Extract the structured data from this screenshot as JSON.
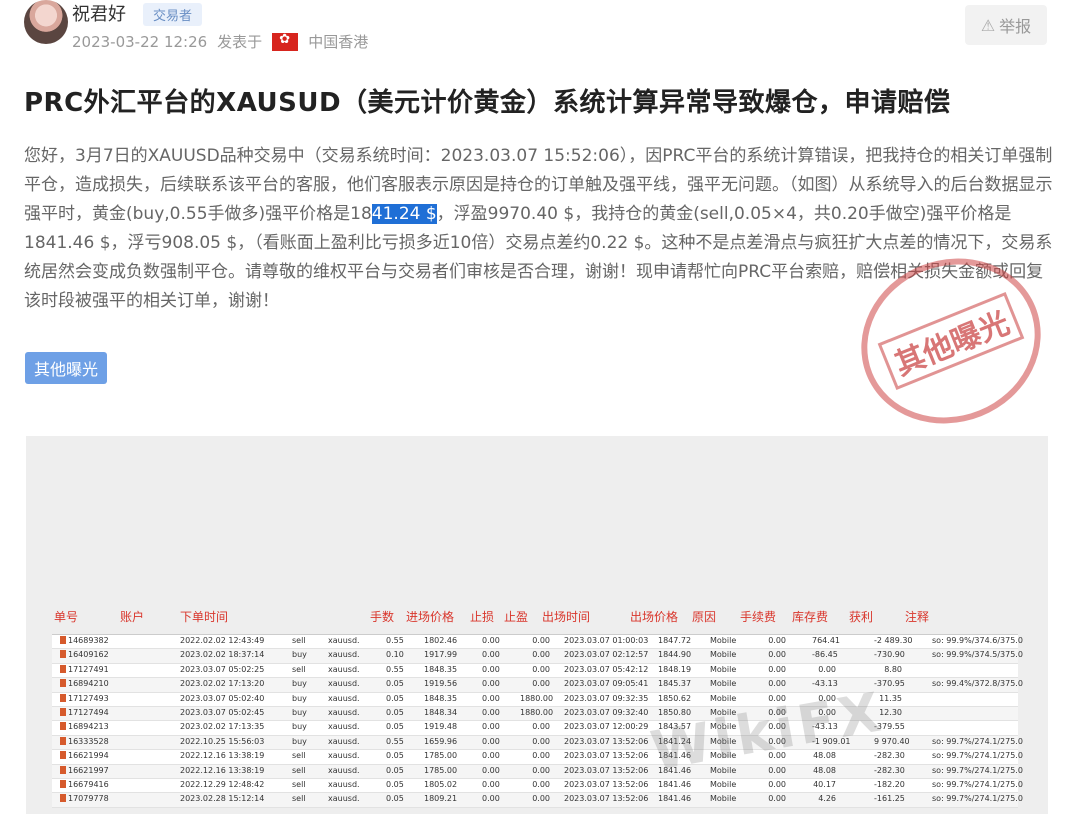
{
  "author": {
    "name": "祝君好",
    "badge": "交易者"
  },
  "post_meta": {
    "date": "2023-03-22 12:26",
    "posted_in": "发表于",
    "region": "中国香港"
  },
  "report_label": "举报",
  "title": "PRC外汇平台的XAUSUD（美元计价黄金）系统计算异常导致爆仓，申请赔偿",
  "body": {
    "before_hl": "您好，3月7日的XAUUSD品种交易中（交易系统时间：2023.03.07 15:52:06），因PRC平台的系统计算错误，把我持仓的相关订单强制平仓，造成损失，后续联系该平台的客服，他们客服表示原因是持仓的订单触及强平线，强平无问题。（如图）从系统导入的后台数据显示强平时，黄金(buy,0.55手做多)强平价格是18",
    "highlight": "41.24 $",
    "after_hl": "，浮盈9970.40 $，我持仓的黄金(sell,0.05×4，共0.20手做空)强平价格是1841.46 $，浮亏908.05 $，（看账面上盈利比亏损多近10倍）交易点差约0.22 $。这种不是点差滑点与疯狂扩大点差的情况下，交易系统居然会变成负数强制平仓。请尊敬的维权平台与交易者们审核是否合理，谢谢！现申请帮忙向PRC平台索赔，赔偿相关损失金额或回复该时段被强平的相关订单，谢谢！"
  },
  "tag": "其他曝光",
  "stamp_text": "其他曝光",
  "watermark_text": "WikiFX",
  "icons": {
    "report": "warning-triangle-icon",
    "flag": "hong-kong-flag-icon"
  },
  "colors": {
    "highlight": "#1f6fd6",
    "tag": "#6ea0e6",
    "header_red": "#d9362c"
  },
  "table": {
    "headers": [
      "单号",
      "账户",
      "下单时间",
      "手数",
      "进场价格",
      "止损",
      "止盈",
      "出场时间",
      "出场价格",
      "原因",
      "手续费",
      "库存费",
      "获利",
      "注释"
    ],
    "rows": [
      [
        "14689382",
        "",
        "2022.02.02 12:43:49",
        "sell",
        "xauusd.",
        "0.55",
        "1802.46",
        "0.00",
        "0.00",
        "2023.03.07 01:00:03",
        "1847.72",
        "Mobile",
        "0.00",
        "764.41",
        "-2 489.30",
        "so: 99.9%/374.6/375.0"
      ],
      [
        "16409162",
        "",
        "2023.02.02 18:37:14",
        "buy",
        "xauusd.",
        "0.10",
        "1917.99",
        "0.00",
        "0.00",
        "2023.03.07 02:12:57",
        "1844.90",
        "Mobile",
        "0.00",
        "-86.45",
        "-730.90",
        "so: 99.9%/374.5/375.0"
      ],
      [
        "17127491",
        "",
        "2023.03.07 05:02:25",
        "sell",
        "xauusd.",
        "0.55",
        "1848.35",
        "0.00",
        "0.00",
        "2023.03.07 05:42:12",
        "1848.19",
        "Mobile",
        "0.00",
        "0.00",
        "8.80",
        ""
      ],
      [
        "16894210",
        "",
        "2023.02.02 17:13:20",
        "buy",
        "xauusd.",
        "0.05",
        "1919.56",
        "0.00",
        "0.00",
        "2023.03.07 09:05:41",
        "1845.37",
        "Mobile",
        "0.00",
        "-43.13",
        "-370.95",
        "so: 99.4%/372.8/375.0"
      ],
      [
        "17127493",
        "",
        "2023.03.07 05:02:40",
        "buy",
        "xauusd.",
        "0.05",
        "1848.35",
        "0.00",
        "1880.00",
        "2023.03.07 09:32:35",
        "1850.62",
        "Mobile",
        "0.00",
        "0.00",
        "11.35",
        ""
      ],
      [
        "17127494",
        "",
        "2023.03.07 05:02:45",
        "buy",
        "xauusd.",
        "0.05",
        "1848.34",
        "0.00",
        "1880.00",
        "2023.03.07 09:32:40",
        "1850.80",
        "Mobile",
        "0.00",
        "0.00",
        "12.30",
        ""
      ],
      [
        "16894213",
        "",
        "2023.02.02 17:13:35",
        "buy",
        "xauusd.",
        "0.05",
        "1919.48",
        "0.00",
        "0.00",
        "2023.03.07 12:00:29",
        "1843.57",
        "Mobile",
        "0.00",
        "-43.13",
        "-379.55",
        ""
      ],
      [
        "16333528",
        "",
        "2022.10.25 15:56:03",
        "buy",
        "xauusd.",
        "0.55",
        "1659.96",
        "0.00",
        "0.00",
        "2023.03.07 13:52:06",
        "1841.24",
        "Mobile",
        "0.00",
        "-1 909.01",
        "9 970.40",
        "so: 99.7%/274.1/275.0"
      ],
      [
        "16621994",
        "",
        "2022.12.16 13:38:19",
        "sell",
        "xauusd.",
        "0.05",
        "1785.00",
        "0.00",
        "0.00",
        "2023.03.07 13:52:06",
        "1841.46",
        "Mobile",
        "0.00",
        "48.08",
        "-282.30",
        "so: 99.7%/274.1/275.0"
      ],
      [
        "16621997",
        "",
        "2022.12.16 13:38:19",
        "sell",
        "xauusd.",
        "0.05",
        "1785.00",
        "0.00",
        "0.00",
        "2023.03.07 13:52:06",
        "1841.46",
        "Mobile",
        "0.00",
        "48.08",
        "-282.30",
        "so: 99.7%/274.1/275.0"
      ],
      [
        "16679416",
        "",
        "2022.12.29 12:48:42",
        "sell",
        "xauusd.",
        "0.05",
        "1805.02",
        "0.00",
        "0.00",
        "2023.03.07 13:52:06",
        "1841.46",
        "Mobile",
        "0.00",
        "40.17",
        "-182.20",
        "so: 99.7%/274.1/275.0"
      ],
      [
        "17079778",
        "",
        "2023.02.28 15:12:14",
        "sell",
        "xauusd.",
        "0.05",
        "1809.21",
        "0.00",
        "0.00",
        "2023.03.07 13:52:06",
        "1841.46",
        "Mobile",
        "0.00",
        "4.26",
        "-161.25",
        "so: 99.7%/274.1/275.0"
      ]
    ]
  }
}
